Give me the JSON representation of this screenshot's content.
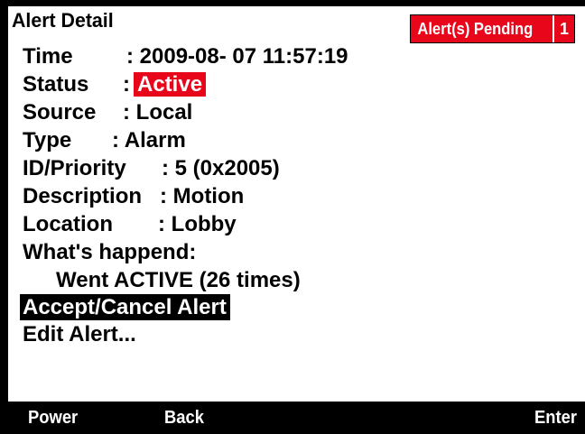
{
  "header": {
    "title": "Alert Detail",
    "pending_label": "Alert(s) Pending",
    "pending_count": "1"
  },
  "details": {
    "time_label": "Time",
    "time_value": ": 2009-08- 07  11:57:19",
    "status_label": "Status",
    "status_sep": ":",
    "status_value": "Active",
    "source_label": "Source",
    "source_value": ": Local",
    "type_label": "Type",
    "type_value": ": Alarm",
    "idpriority_label": "ID/Priority",
    "idpriority_value": ": 5  (0x2005)",
    "description_label": "Description",
    "description_value": ": Motion",
    "location_label": "Location",
    "location_value": ": Lobby",
    "happened_label": "What's happend:",
    "happened_value": "Went ACTIVE (26 times)"
  },
  "menu": {
    "items": [
      {
        "label": "Accept/Cancel Alert",
        "selected": true
      },
      {
        "label": "Edit Alert...",
        "selected": false
      }
    ]
  },
  "softkeys": {
    "left": "Power",
    "middle": "Back",
    "right": "Enter"
  },
  "colors": {
    "accent_red": "#e8061a",
    "background": "#ffffff",
    "frame": "#000000"
  }
}
